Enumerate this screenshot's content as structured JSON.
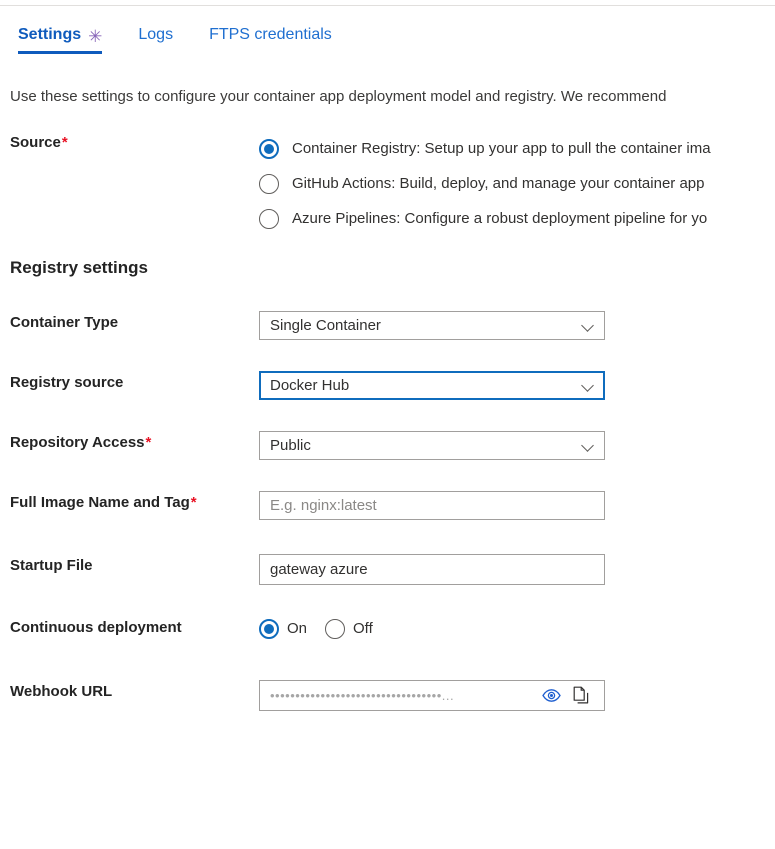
{
  "tabs": [
    {
      "label": "Settings",
      "active": true,
      "dirty_marker": "✳"
    },
    {
      "label": "Logs",
      "active": false
    },
    {
      "label": "FTPS credentials",
      "active": false
    }
  ],
  "description": "Use these settings to configure your container app deployment model and registry. We recommend",
  "source": {
    "label": "Source",
    "required_marker": "*",
    "options": [
      {
        "label": "Container Registry: Setup up your app to pull the container ima",
        "selected": true
      },
      {
        "label": "GitHub Actions: Build, deploy, and manage your container app",
        "selected": false
      },
      {
        "label": "Azure Pipelines: Configure a robust deployment pipeline for yo",
        "selected": false
      }
    ]
  },
  "registry_settings": {
    "heading": "Registry settings",
    "container_type": {
      "label": "Container Type",
      "value": "Single Container",
      "icon": "chevron-down-icon"
    },
    "registry_source": {
      "label": "Registry source",
      "value": "Docker Hub",
      "focused": true,
      "icon": "chevron-down-icon"
    },
    "repository_access": {
      "label": "Repository Access",
      "required_marker": "*",
      "value": "Public",
      "icon": "chevron-down-icon"
    },
    "full_image_name": {
      "label": "Full Image Name and Tag",
      "required_marker": "*",
      "value": "",
      "placeholder": "E.g. nginx:latest"
    },
    "startup_file": {
      "label": "Startup File",
      "value": "gateway azure",
      "placeholder": ""
    },
    "continuous_deployment": {
      "label": "Continuous deployment",
      "options": [
        {
          "label": "On",
          "selected": true
        },
        {
          "label": "Off",
          "selected": false
        }
      ]
    },
    "webhook_url": {
      "label": "Webhook URL",
      "masked_value": "••••••••••••••••••••••••••••••••••",
      "truncation": "...",
      "reveal_icon": "eye-icon",
      "copy_icon": "copy-icon"
    }
  },
  "colors": {
    "accent": "#0f6cbd",
    "tab_active": "#0f5bbd",
    "tab_inactive": "#1f6fd0",
    "required": "#e81123",
    "dirty": "#8764b8"
  }
}
